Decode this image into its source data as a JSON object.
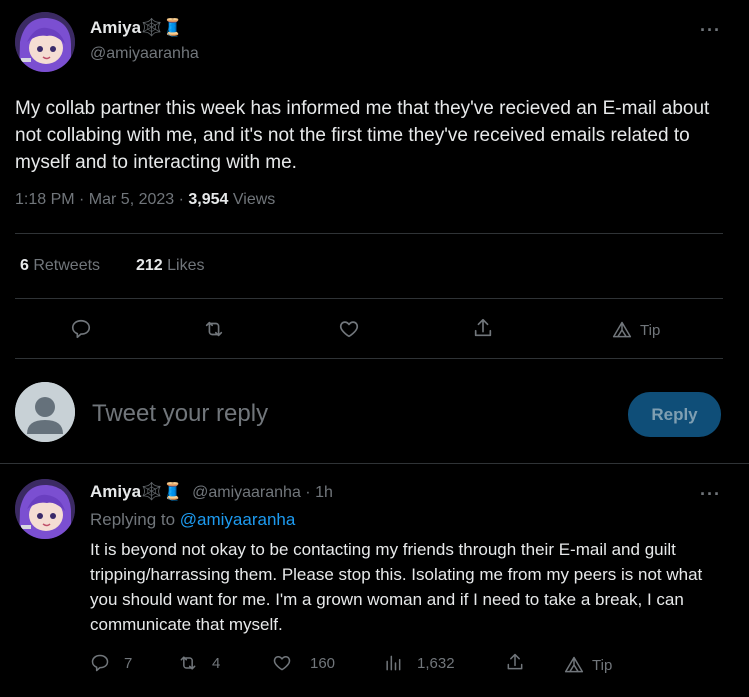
{
  "main_tweet": {
    "author_name": "Amiya",
    "author_emoji": "🕸️🧵",
    "author_handle": "@amiyaaranha",
    "more": "···",
    "text": "My collab partner this week has informed me that they've recieved an E-mail about not collabing with me, and it's not the first time they've received emails related to myself and to interacting with me.",
    "time": "1:18 PM · Mar 5, 2023 · ",
    "views_count": "3,954",
    "views_label": " Views",
    "retweets_count": "6",
    "retweets_label": " Retweets",
    "likes_count": "212",
    "likes_label": " Likes",
    "tip_label": "Tip"
  },
  "composer": {
    "placeholder": "Tweet your reply",
    "reply_button": "Reply"
  },
  "reply_tweet": {
    "author_name": "Amiya",
    "author_emoji": "🕸️🧵",
    "meta": "@amiyaaranha · 1h",
    "more": "···",
    "replying_prefix": "Replying to ",
    "replying_handle": "@amiyaaranha",
    "text": "It is beyond not okay to be contacting my friends through their E-mail and guilt tripping/harrassing them.  Please stop this. Isolating me from my peers is not what you should want for me. I'm a grown woman and if I need to take a break, I can communicate that myself.",
    "replies": "7",
    "retweets": "4",
    "likes": "160",
    "views": "1,632",
    "tip_label": "Tip"
  },
  "colors": {
    "background": "#000000",
    "text": "#e7e9ea",
    "muted": "#71767b",
    "link": "#1d9bf0",
    "reply_button": "#0f4e78",
    "divider": "#2f3336"
  }
}
